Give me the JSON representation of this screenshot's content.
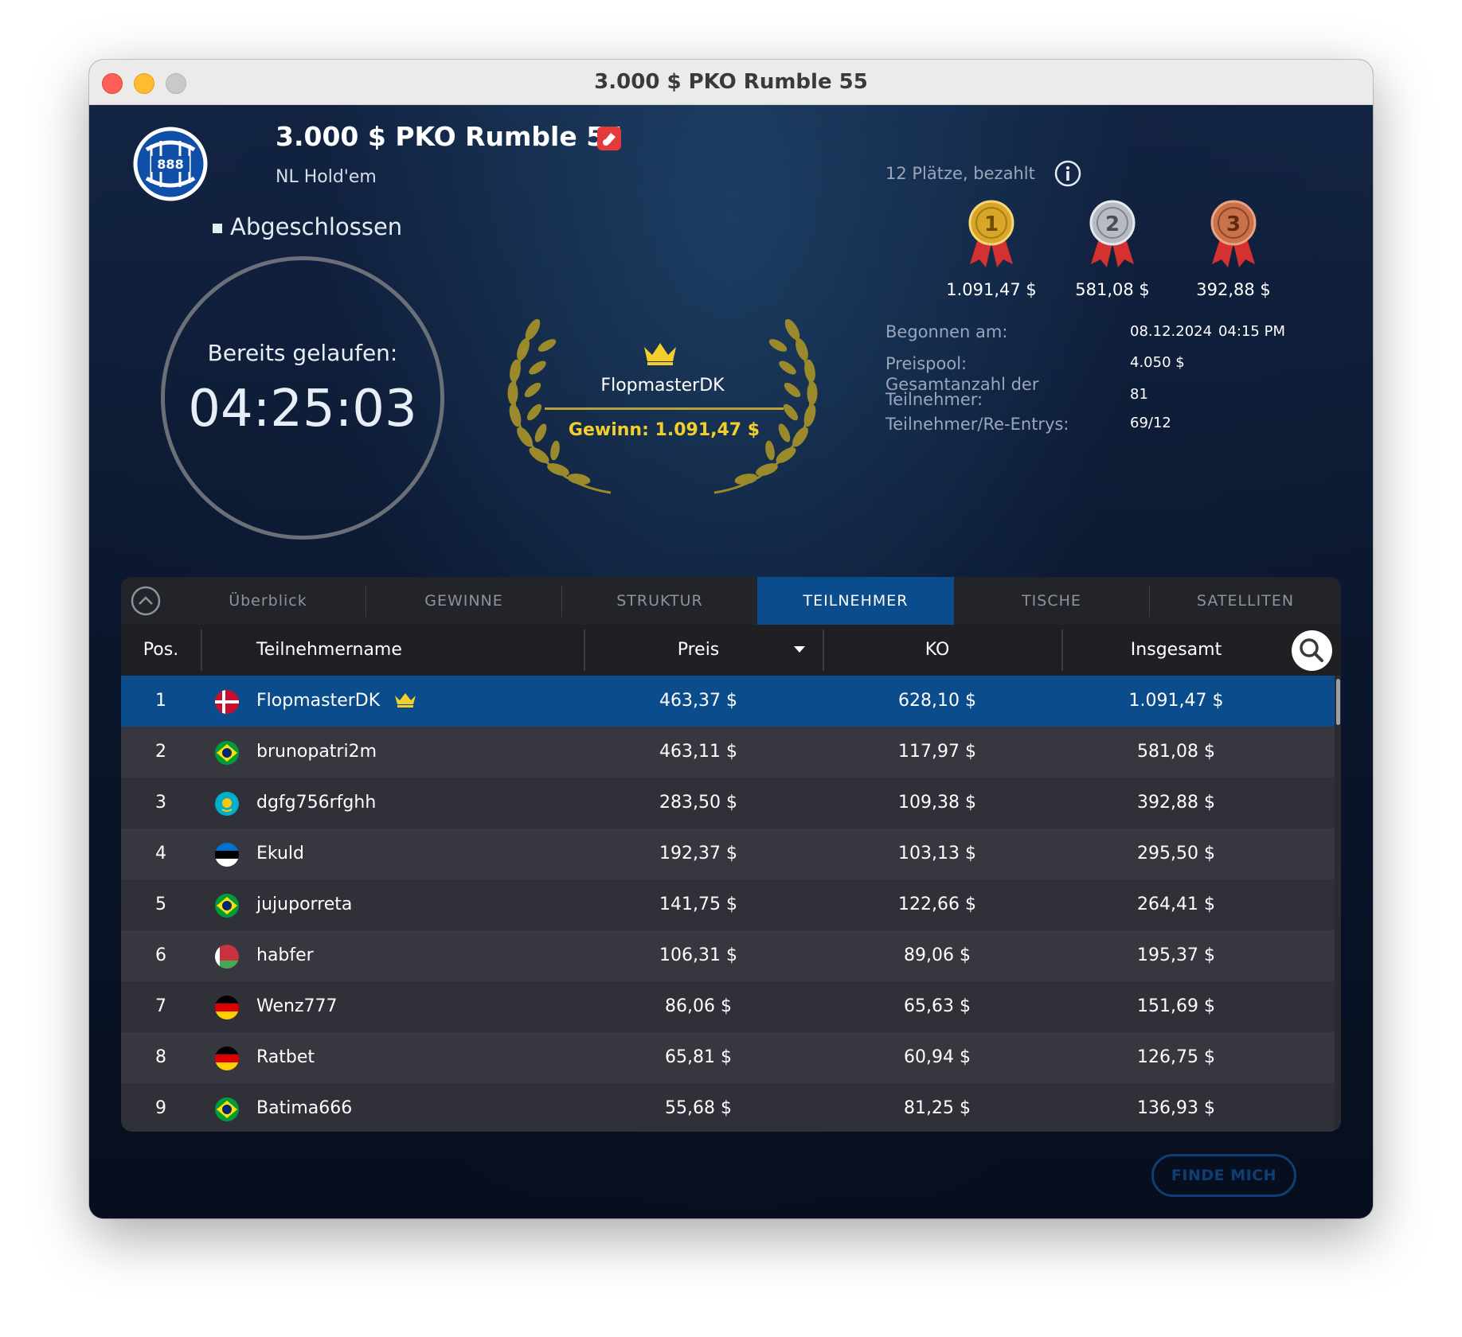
{
  "window": {
    "title": "3.000 $ PKO Rumble 55"
  },
  "header": {
    "title": "3.000 $ PKO Rumble 55",
    "game_type": "NL Hold'em",
    "status": "Abgeschlossen",
    "logo_text": "888"
  },
  "timer": {
    "label": "Bereits gelaufen:",
    "value": "04:25:03"
  },
  "winner": {
    "name": "FlopmasterDK",
    "gain": "Gewinn: 1.091,47 $"
  },
  "payouts": {
    "paid_places": "12 Plätze, bezahlt",
    "medals": [
      {
        "rank": "1",
        "amount": "1.091,47 $",
        "color": "#d8a628"
      },
      {
        "rank": "2",
        "amount": "581,08 $",
        "color": "#b7bcc4"
      },
      {
        "rank": "3",
        "amount": "392,88 $",
        "color": "#c9714a"
      }
    ]
  },
  "stats": {
    "started_label": "Begonnen am:",
    "started_date": "08.12.2024",
    "started_time": "04:15 PM",
    "prizepool_label": "Preispool:",
    "prizepool_value": "4.050 $",
    "total_label_1": "Gesamtanzahl der",
    "total_label_2": "Teilnehmer:",
    "total_value": "81",
    "reentry_label": "Teilnehmer/Re-Entrys:",
    "reentry_value": "69/12"
  },
  "tabs": [
    {
      "label": "Überblick",
      "active": false
    },
    {
      "label": "GEWINNE",
      "active": false
    },
    {
      "label": "STRUKTUR",
      "active": false
    },
    {
      "label": "TEILNEHMER",
      "active": true
    },
    {
      "label": "TISCHE",
      "active": false
    },
    {
      "label": "SATELLITEN",
      "active": false
    }
  ],
  "table": {
    "columns": {
      "pos": "Pos.",
      "name": "Teilnehmername",
      "preis": "Preis",
      "ko": "KO",
      "total": "Insgesamt"
    },
    "rows": [
      {
        "pos": "1",
        "flag": "denmark",
        "name": "FlopmasterDK",
        "preis": "463,37 $",
        "ko": "628,10 $",
        "total": "1.091,47 $",
        "winner": true
      },
      {
        "pos": "2",
        "flag": "brazil",
        "name": "brunopatri2m",
        "preis": "463,11 $",
        "ko": "117,97 $",
        "total": "581,08 $"
      },
      {
        "pos": "3",
        "flag": "kazakhstan",
        "name": "dgfg756rfghh",
        "preis": "283,50 $",
        "ko": "109,38 $",
        "total": "392,88 $"
      },
      {
        "pos": "4",
        "flag": "estonia",
        "name": "Ekuld",
        "preis": "192,37 $",
        "ko": "103,13 $",
        "total": "295,50 $"
      },
      {
        "pos": "5",
        "flag": "brazil",
        "name": "jujuporreta",
        "preis": "141,75 $",
        "ko": "122,66 $",
        "total": "264,41 $"
      },
      {
        "pos": "6",
        "flag": "belarus",
        "name": "habfer",
        "preis": "106,31 $",
        "ko": "89,06 $",
        "total": "195,37 $"
      },
      {
        "pos": "7",
        "flag": "germany",
        "name": "Wenz777",
        "preis": "86,06 $",
        "ko": "65,63 $",
        "total": "151,69 $"
      },
      {
        "pos": "8",
        "flag": "germany",
        "name": "Ratbet",
        "preis": "65,81 $",
        "ko": "60,94 $",
        "total": "126,75 $"
      },
      {
        "pos": "9",
        "flag": "brazil",
        "name": "Batima666",
        "preis": "55,68 $",
        "ko": "81,25 $",
        "total": "136,93 $"
      }
    ]
  },
  "find_me": "FINDE MICH"
}
